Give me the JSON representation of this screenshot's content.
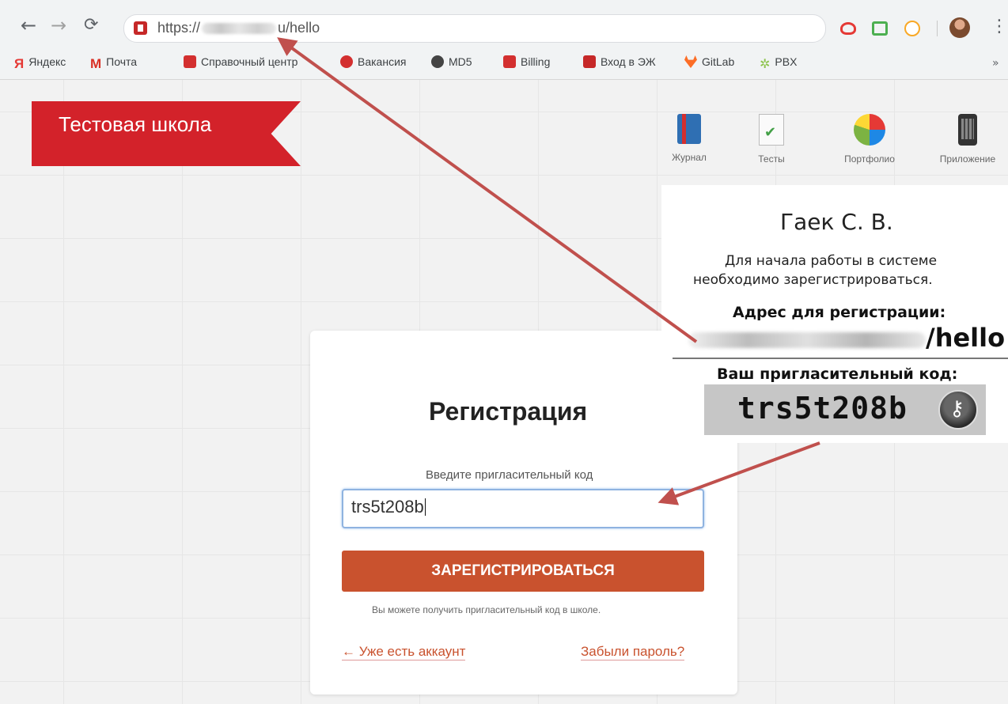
{
  "browser": {
    "url_prefix": "https://",
    "url_suffix": "u/hello",
    "bookmarks": [
      "Яндекс",
      "Почта",
      "Справочный центр",
      "Вакансия",
      "MD5",
      "Billing",
      "Вход в ЭЖ",
      "GitLab",
      "PBX"
    ],
    "more": "»"
  },
  "site": {
    "brand": "Тестовая школа",
    "nav": [
      "Журнал",
      "Тесты",
      "Портфолио",
      "Приложение"
    ]
  },
  "registration": {
    "title": "Регистрация",
    "code_label": "Введите пригласительный код",
    "code_value": "trs5t208b",
    "submit_label": "ЗАРЕГИСТРИРОВАТЬСЯ",
    "hint": "Вы можете получить пригласительный код в школе.",
    "login_link": "← Уже есть аккаунт",
    "forgot_link": "Забыли пароль?"
  },
  "info_panel": {
    "name": "Гаек С. В.",
    "line1": "Для начала работы в системе",
    "line2": "необходимо зарегистрироваться.",
    "address_label": "Адрес для регистрации:",
    "address_suffix": "/hello",
    "invite_label": "Ваш пригласительный код:",
    "invite_code": "trs5t208b"
  },
  "colors": {
    "brand_red": "#d3222a",
    "button_orange": "#c9522e",
    "arrow": "#c0504d"
  }
}
